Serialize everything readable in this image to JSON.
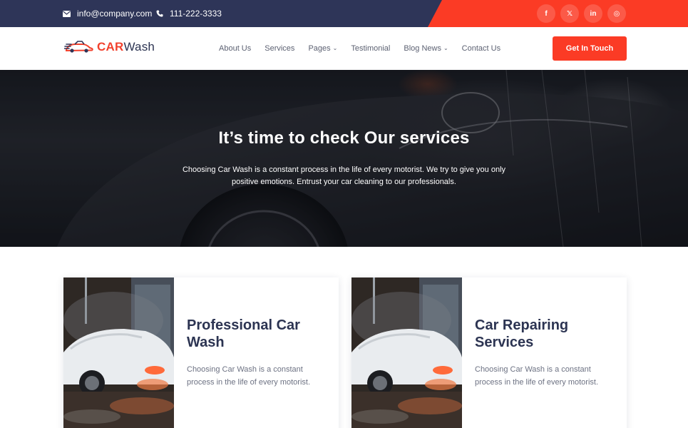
{
  "topbar": {
    "email": "info@company.com",
    "phone": "111-222-3333",
    "socials": [
      {
        "icon": "facebook-icon",
        "glyph": "f"
      },
      {
        "icon": "x-twitter-icon",
        "glyph": "𝕏"
      },
      {
        "icon": "linkedin-icon",
        "glyph": "in"
      },
      {
        "icon": "instagram-icon",
        "glyph": "◎"
      }
    ]
  },
  "header": {
    "logo_car": "CAR",
    "logo_wash": "Wash",
    "nav": [
      {
        "label": "About Us",
        "dropdown": false
      },
      {
        "label": "Services",
        "dropdown": false
      },
      {
        "label": "Pages",
        "dropdown": true
      },
      {
        "label": "Testimonial",
        "dropdown": false
      },
      {
        "label": "Blog News",
        "dropdown": true
      },
      {
        "label": "Contact Us",
        "dropdown": false
      }
    ],
    "cta_label": "Get In Touch"
  },
  "hero": {
    "title": "It’s time to check Our services",
    "subtitle": "Choosing Car Wash is a constant process in the life of every motorist. We try to give you only positive emotions. Entrust your car cleaning to our professionals."
  },
  "services": [
    {
      "title": "Professional Car Wash",
      "description": "Choosing Car Wash is a constant process in the life of every motorist."
    },
    {
      "title": "Car Repairing Services",
      "description": "Choosing Car Wash is a constant process in the life of every motorist."
    }
  ],
  "colors": {
    "brand_red": "#fb3b25",
    "navy": "#2e3558",
    "heading": "#2c3452"
  }
}
